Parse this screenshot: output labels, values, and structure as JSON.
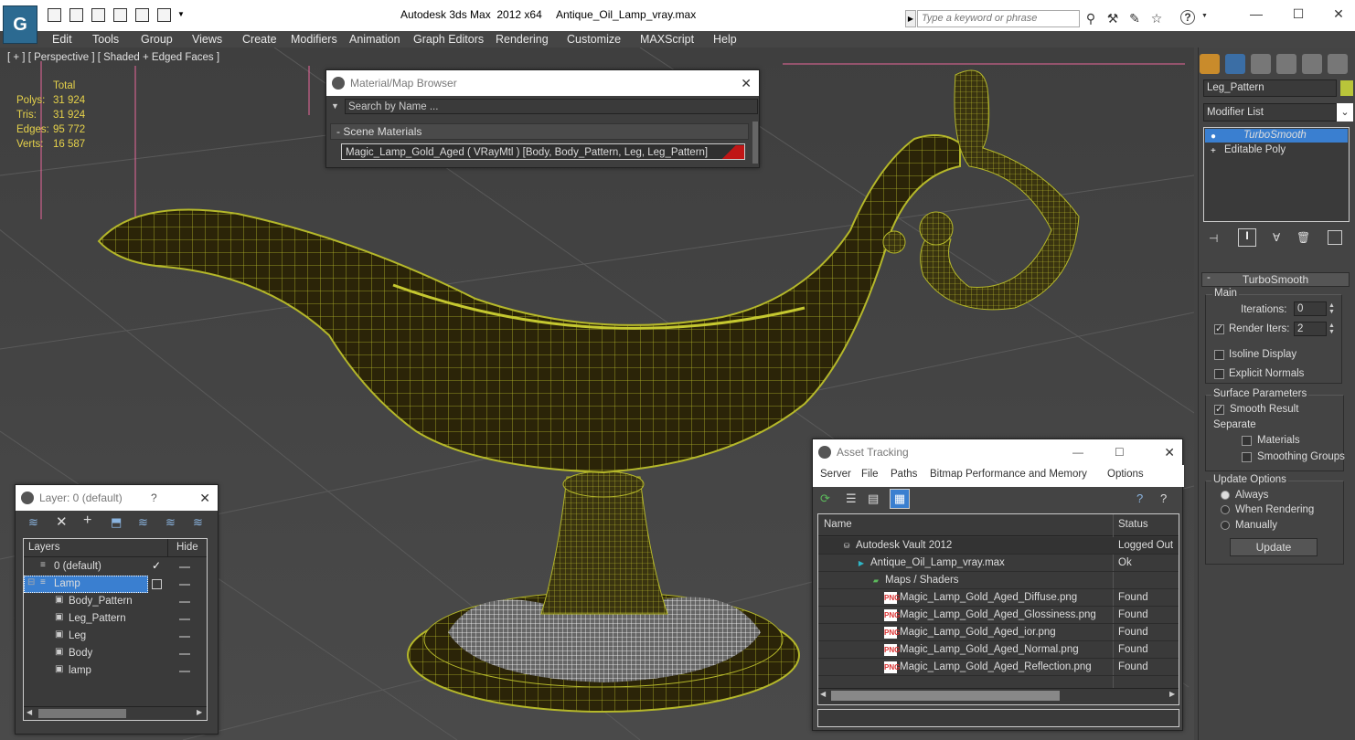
{
  "title_bar": {
    "app": "Autodesk 3ds Max  2012 x64",
    "file": "Antique_Oil_Lamp_vray.max",
    "search_placeholder": "Type a keyword or phrase"
  },
  "menu": [
    "Edit",
    "Tools",
    "Group",
    "Views",
    "Create",
    "Modifiers",
    "Animation",
    "Graph Editors",
    "Rendering",
    "Customize",
    "MAXScript",
    "Help"
  ],
  "viewport": {
    "label": "[ + ] [ Perspective ] [ Shaded + Edged Faces ]",
    "stats": {
      "header": "Total",
      "rows": [
        {
          "label": "Polys:",
          "value": "31 924"
        },
        {
          "label": "Tris:",
          "value": "31 924"
        },
        {
          "label": "Edges:",
          "value": "95 772"
        },
        {
          "label": "Verts:",
          "value": "16 587"
        }
      ]
    }
  },
  "material_browser": {
    "title": "Material/Map Browser",
    "search": "Search by Name ...",
    "section": "- Scene Materials",
    "item": "Magic_Lamp_Gold_Aged  ( VRayMtl ) [Body, Body_Pattern, Leg, Leg_Pattern]"
  },
  "command_panel": {
    "object_name": "Leg_Pattern",
    "modifier_list": "Modifier List",
    "stack": [
      "TurboSmooth",
      "Editable Poly"
    ],
    "rollout": "TurboSmooth",
    "main": "Main",
    "iterations_label": "Iterations:",
    "iterations": "0",
    "render_iters_label": "Render Iters:",
    "render_iters": "2",
    "isoline": "Isoline Display",
    "explicit": "Explicit Normals",
    "surface": "Surface Parameters",
    "smooth": "Smooth Result",
    "separate": "Separate",
    "materials": "Materials",
    "smoothing": "Smoothing Groups",
    "update_opts": "Update Options",
    "always": "Always",
    "when_rendering": "When Rendering",
    "manually": "Manually",
    "update_btn": "Update"
  },
  "layer_dialog": {
    "title": "Layer: 0 (default)",
    "help": "?",
    "col_layers": "Layers",
    "col_hide": "Hide",
    "rows": [
      {
        "name": "0 (default)",
        "indent": 1
      },
      {
        "name": "Lamp",
        "indent": 1
      },
      {
        "name": "Body_Pattern",
        "indent": 2
      },
      {
        "name": "Leg_Pattern",
        "indent": 2
      },
      {
        "name": "Leg",
        "indent": 2
      },
      {
        "name": "Body",
        "indent": 2
      },
      {
        "name": "lamp",
        "indent": 2
      }
    ]
  },
  "asset_tracking": {
    "title": "Asset Tracking",
    "menu": [
      "Server",
      "File",
      "Paths",
      "Bitmap Performance and Memory",
      "Options"
    ],
    "col_name": "Name",
    "col_status": "Status",
    "rows": [
      {
        "name": "Autodesk Vault 2012",
        "status": "Logged Out",
        "indent": 1
      },
      {
        "name": "Antique_Oil_Lamp_vray.max",
        "status": "Ok",
        "indent": 2
      },
      {
        "name": "Maps / Shaders",
        "status": "",
        "indent": 3
      },
      {
        "name": "Magic_Lamp_Gold_Aged_Diffuse.png",
        "status": "Found",
        "indent": 4
      },
      {
        "name": "Magic_Lamp_Gold_Aged_Glossiness.png",
        "status": "Found",
        "indent": 4
      },
      {
        "name": "Magic_Lamp_Gold_Aged_ior.png",
        "status": "Found",
        "indent": 4
      },
      {
        "name": "Magic_Lamp_Gold_Aged_Normal.png",
        "status": "Found",
        "indent": 4
      },
      {
        "name": "Magic_Lamp_Gold_Aged_Reflection.png",
        "status": "Found",
        "indent": 4
      }
    ]
  },
  "colors": {
    "accent": "#3a7fd0",
    "wire": "#b5b82a",
    "stat": "#e6d24a"
  }
}
